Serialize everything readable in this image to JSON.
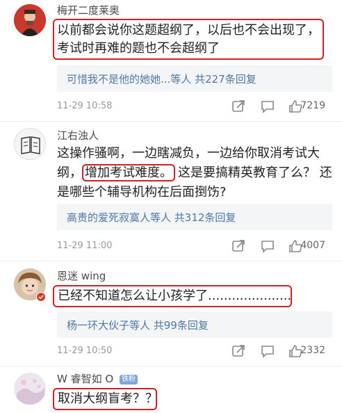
{
  "comments": [
    {
      "user": "梅开二度莱奥",
      "lines": [
        "以前都会说你这题超纲了，以后也不会出现了，",
        "考试时再难的题也不会超纲了"
      ],
      "replies": "可惜我不是他的她她...等人 共227条回复",
      "time": "11-29 10:58",
      "likes": "7219"
    },
    {
      "user": "江右浊人",
      "line1": "这操作骚啊，一边瞎减负，一边给你取消考试大",
      "line2_pre": "纲，",
      "line2_box": "增加考试难度。",
      "line2_post": "这是要搞精英教育了么？ 还",
      "line3": "是哪些个辅导机构在后面捯饬?",
      "replies": "高贵的爱死寂寞人等人 共312条回复",
      "time": "11-29 11:00",
      "likes": "4007"
    },
    {
      "user": "恩迷 wing",
      "line1": "已经不知道怎么让小孩学了........................",
      "replies": "杨一环大伙子等人 共99条回复",
      "time": "11-29 10:50",
      "likes": "2332"
    },
    {
      "user": "W 睿智如 O",
      "badge": "铁粉",
      "line1": "取消大纲盲考？？"
    }
  ]
}
